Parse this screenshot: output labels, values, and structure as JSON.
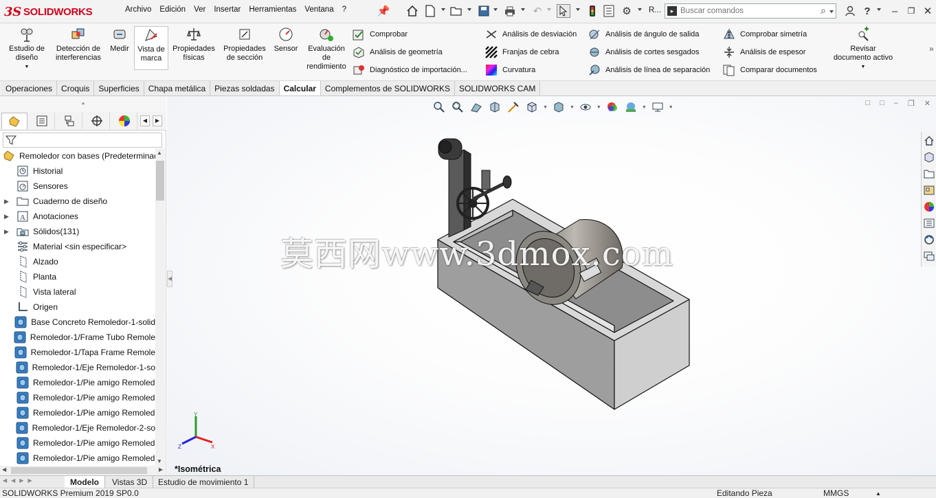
{
  "app": {
    "logo_text": "SOLIDWORKS",
    "logo_ds": "3S",
    "menu": [
      "Archivo",
      "Edición",
      "Ver",
      "Insertar",
      "Herramientas",
      "Ventana",
      "?"
    ],
    "search_placeholder": "Buscar comandos",
    "rebuild_label": "R..."
  },
  "toolbar_big": [
    {
      "label": "Estudio de\ndiseño",
      "icon": "design-study-icon"
    },
    {
      "label": "Detección de\ninterferencias",
      "icon": "interference-icon"
    },
    {
      "label": "Medir",
      "icon": "measure-icon"
    },
    {
      "label": "Vista de\nmarca",
      "icon": "markup-view-icon"
    },
    {
      "label": "Propiedades\nfísicas",
      "icon": "mass-properties-icon"
    },
    {
      "label": "Propiedades\nde sección",
      "icon": "section-properties-icon"
    },
    {
      "label": "Sensor",
      "icon": "sensor-icon"
    },
    {
      "label": "Evaluación\nde\nrendimiento",
      "icon": "performance-icon"
    },
    {
      "label": "Revisar\ndocumento activo",
      "icon": "review-doc-icon"
    }
  ],
  "toolbar_small": {
    "col1": [
      "Comprobar",
      "Análisis de geometría",
      "Diagnóstico de importación..."
    ],
    "col2": [
      "Análisis de desviación",
      "Franjas de cebra",
      "Curvatura"
    ],
    "col3": [
      "Análisis de ángulo de salida",
      "Análisis de cortes sesgados",
      "Análisis de línea de separación"
    ],
    "col4": [
      "Comprobar simetría",
      "Análisis de espesor",
      "Comparar documentos"
    ]
  },
  "tabs": [
    "Operaciones",
    "Croquis",
    "Superficies",
    "Chapa metálica",
    "Piezas soldadas",
    "Calcular",
    "Complementos de SOLIDWORKS",
    "SOLIDWORKS CAM"
  ],
  "active_tab": "Calcular",
  "tree": {
    "root": "Remoledor con bases  (Predeterminado",
    "items": [
      {
        "label": "Historial",
        "icon": "history-icon",
        "expand": false
      },
      {
        "label": "Sensores",
        "icon": "sensors-icon",
        "expand": false
      },
      {
        "label": "Cuaderno de diseño",
        "icon": "design-binder-icon",
        "expand": true
      },
      {
        "label": "Anotaciones",
        "icon": "annotations-icon",
        "expand": true
      },
      {
        "label": "Sólidos(131)",
        "icon": "solid-bodies-icon",
        "expand": true
      },
      {
        "label": "Material <sin especificar>",
        "icon": "material-icon",
        "expand": false
      },
      {
        "label": "Alzado",
        "icon": "plane-icon",
        "expand": false
      },
      {
        "label": "Planta",
        "icon": "plane-icon",
        "expand": false
      },
      {
        "label": "Vista lateral",
        "icon": "plane-icon",
        "expand": false
      },
      {
        "label": "Origen",
        "icon": "origin-icon",
        "expand": false
      },
      {
        "label": "Base Concreto Remoledor-1-solid",
        "icon": "part-icon",
        "expand": false
      },
      {
        "label": "Remoledor-1/Frame Tubo Remole",
        "icon": "part-icon",
        "expand": false
      },
      {
        "label": "Remoledor-1/Tapa Frame Remole",
        "icon": "part-icon",
        "expand": false
      },
      {
        "label": "Remoledor-1/Eje Remoledor-1-so",
        "icon": "part-icon",
        "expand": false
      },
      {
        "label": "Remoledor-1/Pie amigo Remoled",
        "icon": "part-icon",
        "expand": false
      },
      {
        "label": "Remoledor-1/Pie amigo Remoled",
        "icon": "part-icon",
        "expand": false
      },
      {
        "label": "Remoledor-1/Pie amigo Remoled",
        "icon": "part-icon",
        "expand": false
      },
      {
        "label": "Remoledor-1/Eje Remoledor-2-so",
        "icon": "part-icon",
        "expand": false
      },
      {
        "label": "Remoledor-1/Pie amigo Remoled",
        "icon": "part-icon",
        "expand": false
      },
      {
        "label": "Remoledor-1/Pie amigo Remoled",
        "icon": "part-icon",
        "expand": false
      }
    ]
  },
  "bottom_tabs": [
    "Modelo",
    "Vistas 3D",
    "Estudio de movimiento 1"
  ],
  "active_bottom_tab": "Modelo",
  "viewport": {
    "view_name": "*Isométrica",
    "watermark": "莫西网www.3dmox.com"
  },
  "status": {
    "product": "SOLIDWORKS Premium 2019 SP0.0",
    "mode": "Editando Pieza",
    "units": "MMGS"
  }
}
